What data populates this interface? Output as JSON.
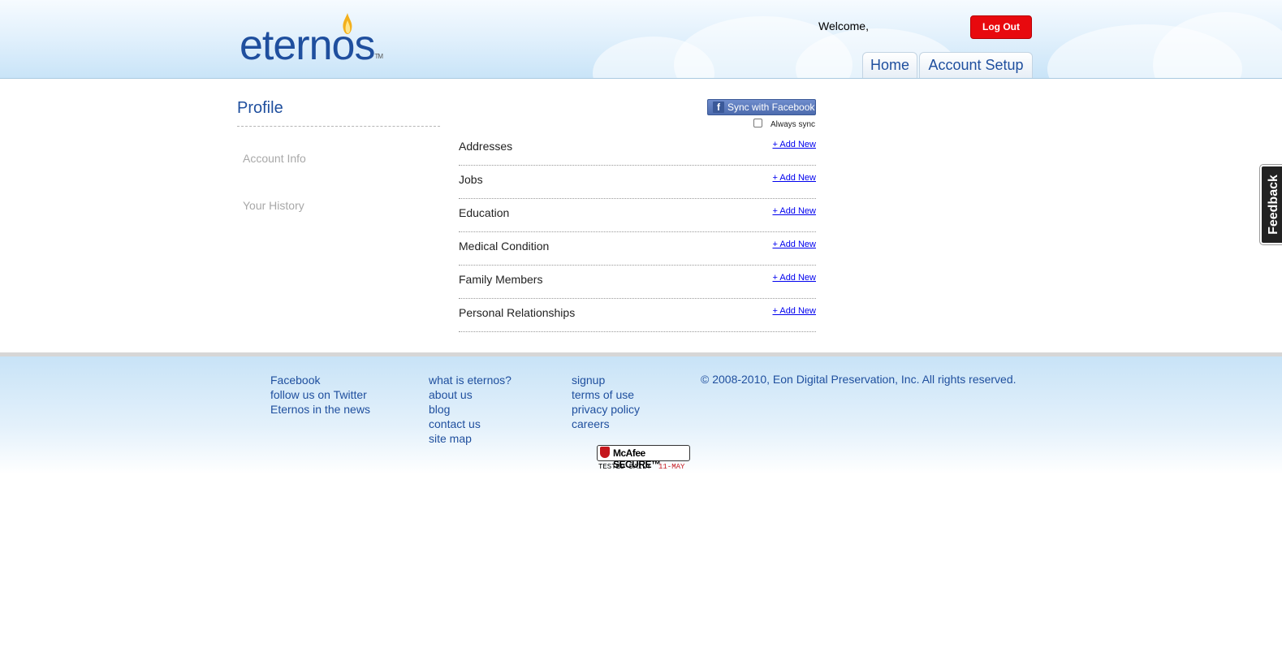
{
  "header": {
    "logo_text": "eternos",
    "welcome": "Welcome,",
    "logout_label": "Log Out",
    "tabs": [
      {
        "label": "Home"
      },
      {
        "label": "Account Setup"
      }
    ]
  },
  "sidebar": {
    "title": "Profile",
    "items": [
      {
        "label": "Account Info"
      },
      {
        "label": "Your History"
      }
    ]
  },
  "main": {
    "facebook_sync_label": "Sync with Facebook",
    "always_sync_label": "Always sync",
    "always_sync_checked": false,
    "sections": [
      {
        "label": "Addresses",
        "action": "+ Add New"
      },
      {
        "label": "Jobs",
        "action": "+ Add New"
      },
      {
        "label": "Education",
        "action": "+ Add New"
      },
      {
        "label": "Medical Condition",
        "action": "+ Add New"
      },
      {
        "label": "Family Members",
        "action": "+ Add New"
      },
      {
        "label": "Personal Relationships",
        "action": "+ Add New"
      }
    ]
  },
  "footer": {
    "col1": [
      "Facebook",
      "follow us on Twitter",
      "Eternos in the news"
    ],
    "col2": [
      "what is eternos?",
      "about us",
      "blog",
      "contact us",
      "site map"
    ],
    "col3": [
      "signup",
      "terms of use",
      "privacy policy",
      "careers"
    ],
    "copyright": "© 2008-2010, Eon Digital Preservation, Inc. All rights reserved.",
    "badge": {
      "name": "McAfee SECURE",
      "tm": "™",
      "tested": "TESTED DAILY",
      "date": "11-MAY"
    }
  },
  "feedback_tab": "Feedback",
  "colors": {
    "brand": "#1f4f9e",
    "logout": "#e8090e",
    "link": "#0000ee",
    "facebook": "#3b5998"
  }
}
